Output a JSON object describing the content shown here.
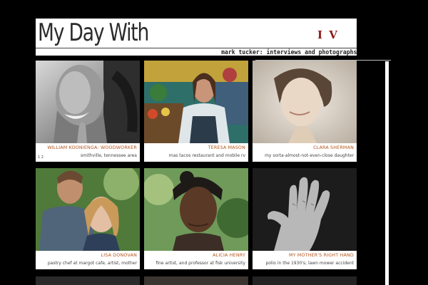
{
  "header": {
    "title": "My Day With",
    "issue": "I V",
    "subtitle": "mark tucker: interviews and photographs"
  },
  "pager": "1 2",
  "tiles": [
    {
      "name": "WILLIAM KOONIENGA: WOODWORKER",
      "desc": "smithville, tennessee area"
    },
    {
      "name": "TERESA MASON",
      "desc": "mas tacos restaurant and mobile rv"
    },
    {
      "name": "CLARA SHERMAN",
      "desc": "my sorta-almost-not-even-close daughter"
    },
    {
      "name": "LISA DONOVAN",
      "desc": "pastry chef at margot cafe, artist, mother"
    },
    {
      "name": "ALICIA HENRY",
      "desc": "fine artist, and professor at fisk university"
    },
    {
      "name": "MY MOTHER'S RIGHT HAND",
      "desc": "polio in the 1930's; lawn mower accident"
    }
  ]
}
